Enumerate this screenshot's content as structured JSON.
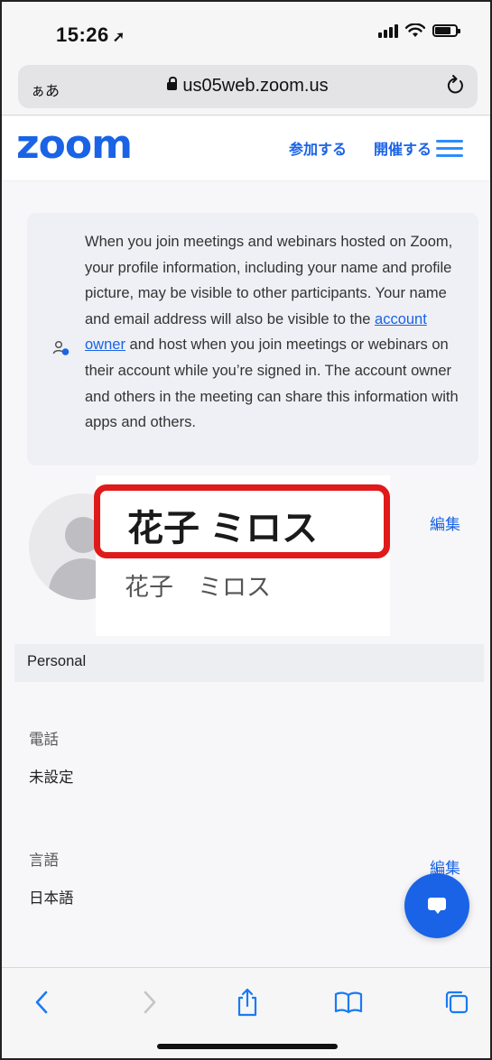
{
  "status_bar": {
    "time": "15:26",
    "location_arrow": "➚",
    "battery_level": 0.75
  },
  "address_bar": {
    "text_size_button": "ぁあ",
    "url": "us05web.zoom.us",
    "reload_icon": "reload-icon"
  },
  "header": {
    "logo": "zoom",
    "join_label": "参加する",
    "host_label": "開催する",
    "accent_color": "#1a63e6"
  },
  "notice": {
    "text_before_link": "When you join meetings and webinars hosted on Zoom, your profile information, including your name and profile picture, may be visible to other participants. Your name and email address will also be visible to the ",
    "link_text": "account owner",
    "text_after_link": " and host when you join meetings or webinars on their account while you’re signed in. The account owner and others in the meeting can share this information with apps and others."
  },
  "profile": {
    "display_name": "花子 ミロス",
    "full_name": "花子　ミロス",
    "edit_label": "編集",
    "highlight_color": "#e01a1a"
  },
  "section": {
    "title": "Personal"
  },
  "fields": {
    "phone_label": "電話",
    "phone_value": "未設定",
    "language_label": "言語",
    "language_value": "日本語",
    "language_edit_label": "編集"
  }
}
